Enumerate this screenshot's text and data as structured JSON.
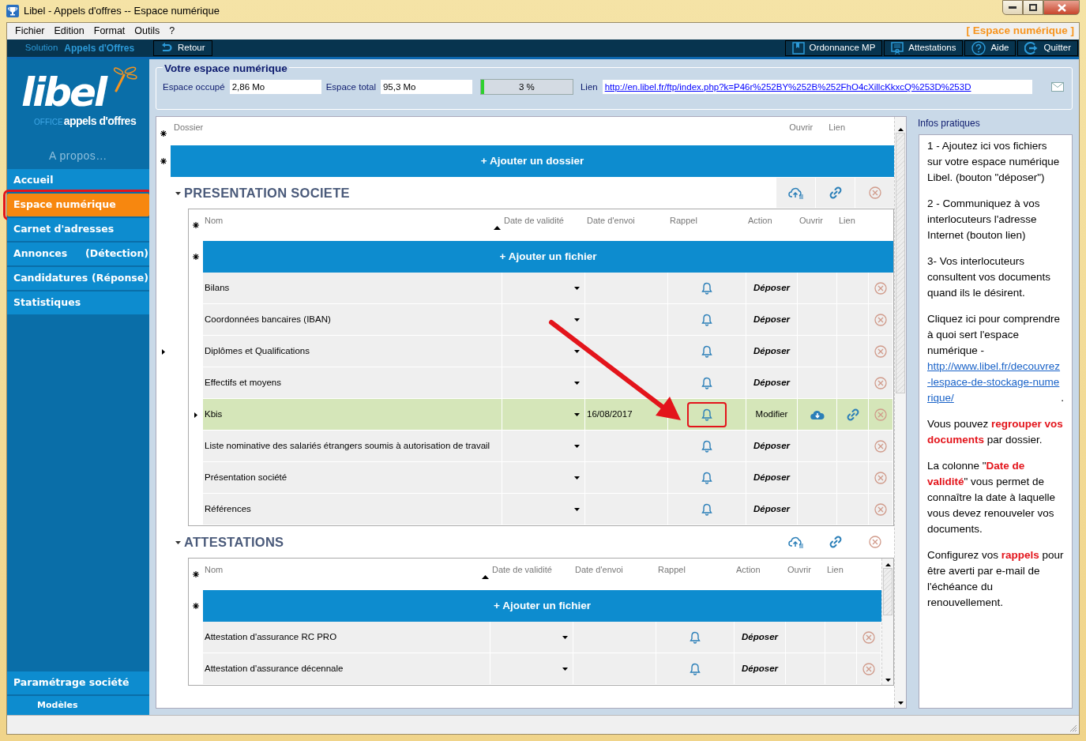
{
  "window": {
    "title": "Libel - Appels d'offres -- Espace numérique"
  },
  "menu": [
    "Fichier",
    "Edition",
    "Format",
    "Outils",
    "?"
  ],
  "context_label": "[ Espace numérique ]",
  "toolbar": {
    "solution_label": "Solution",
    "solution_name": "Appels d'Offres",
    "left_buttons": [
      "Retour"
    ],
    "right_buttons": [
      "Ordonnance MP",
      "Attestations",
      "Aide",
      "Quitter"
    ]
  },
  "sidebar": {
    "logo": {
      "brand": "libel",
      "prefix": "OFFICE",
      "product": "appels d'offres"
    },
    "about": "A propos…",
    "items": [
      {
        "label": "Accueil",
        "selected": false,
        "highlighted": false
      },
      {
        "label": "Espace numérique",
        "selected": true,
        "highlighted": true
      },
      {
        "label": "Carnet d'adresses",
        "selected": false,
        "highlighted": false
      },
      {
        "label": "Annonces",
        "note": "(Détection)",
        "selected": false,
        "highlighted": false
      },
      {
        "label": "Candidatures",
        "note": "(Réponse)",
        "selected": false,
        "highlighted": false
      },
      {
        "label": "Statistiques",
        "selected": false,
        "highlighted": false
      }
    ],
    "bottom_items": [
      {
        "label": "Paramétrage société"
      },
      {
        "label": "Modèles"
      }
    ]
  },
  "space": {
    "title": "Votre espace numérique",
    "used_label": "Espace occupé",
    "used_value": "2,86 Mo",
    "total_label": "Espace total",
    "total_value": "95,3 Mo",
    "usage": {
      "level": 0.03,
      "reading": "3 %"
    },
    "link_label": "Lien",
    "link_value": "http://en.libel.fr/ftp/index.php?k=P46r%252BY%252B%252FhO4cXillcKkxcQ%253D%253D"
  },
  "folders": {
    "columns": [
      "Dossier",
      "Ouvrir",
      "Lien"
    ],
    "add_button": "+ Ajouter un dossier",
    "groups": [
      {
        "name": "PRESENTATION SOCIETE",
        "expanded": true,
        "selected": true,
        "columns": [
          "Nom",
          "Date de validité",
          "Date d'envoi",
          "Rappel",
          "Action",
          "Ouvrir",
          "Lien"
        ],
        "add_button": "+ Ajouter un fichier",
        "scrollable": false,
        "rows": [
          {
            "name": "Bilans",
            "action": "Déposer",
            "uploaded": false,
            "selected": false,
            "reminder_highlighted": false
          },
          {
            "name": "Coordonnées bancaires (IBAN)",
            "action": "Déposer",
            "uploaded": false,
            "selected": false,
            "reminder_highlighted": false
          },
          {
            "name": "Diplômes et Qualifications",
            "action": "Déposer",
            "uploaded": false,
            "selected": false,
            "reminder_highlighted": false
          },
          {
            "name": "Effectifs et moyens",
            "action": "Déposer",
            "uploaded": false,
            "selected": false,
            "reminder_highlighted": false
          },
          {
            "name": "Kbis",
            "sent_date": "16/08/2017",
            "action": "Modifier",
            "uploaded": true,
            "selected": true,
            "reminder_highlighted": true
          },
          {
            "name": "Liste nominative des salariés étrangers soumis à autorisation de travail",
            "action": "Déposer",
            "uploaded": false,
            "selected": false,
            "reminder_highlighted": false
          },
          {
            "name": "Présentation société",
            "action": "Déposer",
            "uploaded": false,
            "selected": false,
            "reminder_highlighted": false
          },
          {
            "name": "Références",
            "action": "Déposer",
            "uploaded": false,
            "selected": false,
            "reminder_highlighted": false
          }
        ]
      },
      {
        "name": "ATTESTATIONS",
        "expanded": true,
        "selected": false,
        "columns": [
          "Nom",
          "Date de validité",
          "Date d'envoi",
          "Rappel",
          "Action",
          "Ouvrir",
          "Lien"
        ],
        "add_button": "+ Ajouter un fichier",
        "scrollable": true,
        "rows": [
          {
            "name": "Attestation  d'assurance RC PRO",
            "action": "Déposer",
            "uploaded": false,
            "selected": false,
            "reminder_highlighted": false
          },
          {
            "name": "Attestation d'assurance décennale",
            "action": "Déposer",
            "uploaded": false,
            "selected": false,
            "reminder_highlighted": false
          }
        ]
      }
    ]
  },
  "info": {
    "title": "Infos pratiques",
    "paragraphs": [
      {
        "text": "1 - Ajoutez ici vos fichiers sur votre espace numérique Libel. (bouton \"déposer\")"
      },
      {
        "text": "2 - Communiquez à vos interlocuteurs l'adresse Internet (bouton lien)"
      },
      {
        "text": "3- Vos interlocuteurs consultent vos documents quand ils le désirent."
      },
      {
        "text": "Cliquez ici pour comprendre à quoi sert l'espace numérique -",
        "link": "http://www.libel.fr/decouvrez-lespace-de-stockage-numerique/",
        "tail": "."
      },
      {
        "text": "Vous pouvez **regrouper vos documents** par dossier."
      },
      {
        "text": "La colonne \"**Date de validité**\" vous permet de connaître la date à laquelle vous devez renouveler vos documents."
      },
      {
        "text": "Configurez vos **rappels** pour être averti par e-mail de l'échéance du renouvellement."
      }
    ]
  }
}
